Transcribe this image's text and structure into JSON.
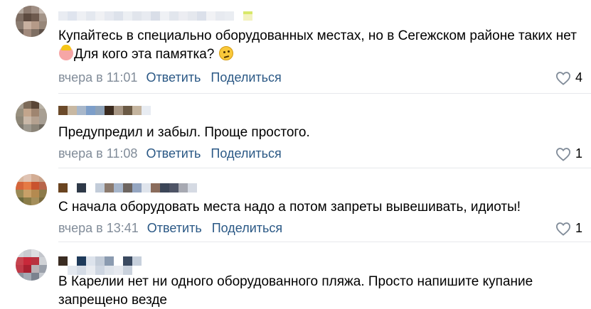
{
  "comments": [
    {
      "text_before": "Купайтесь в специально оборудованных местах, но в Сегежском районе таких нет",
      "text_middle": "Для кого эта памятка?",
      "emoji_1": "woman-gesturing-icon",
      "emoji_2": "thinking-face-icon",
      "time": "вчера в 11:01",
      "reply": "Ответить",
      "share": "Поделиться",
      "likes": "4"
    },
    {
      "text": "Предупредил и забыл. Проще простого.",
      "time": "вчера в 11:08",
      "reply": "Ответить",
      "share": "Поделиться",
      "likes": "1"
    },
    {
      "text": "С начала оборудовать места надо а потом запреты вывешивать, идиоты!",
      "time": "вчера в 13:41",
      "reply": "Ответить",
      "share": "Поделиться",
      "likes": "1"
    },
    {
      "text": "В Карелии нет ни одного оборудованного пляжа. Просто напишите купание запрещено везде"
    }
  ],
  "colors": {
    "link": "#2a5885",
    "meta": "#818c99",
    "divider": "#e7e8ec"
  }
}
